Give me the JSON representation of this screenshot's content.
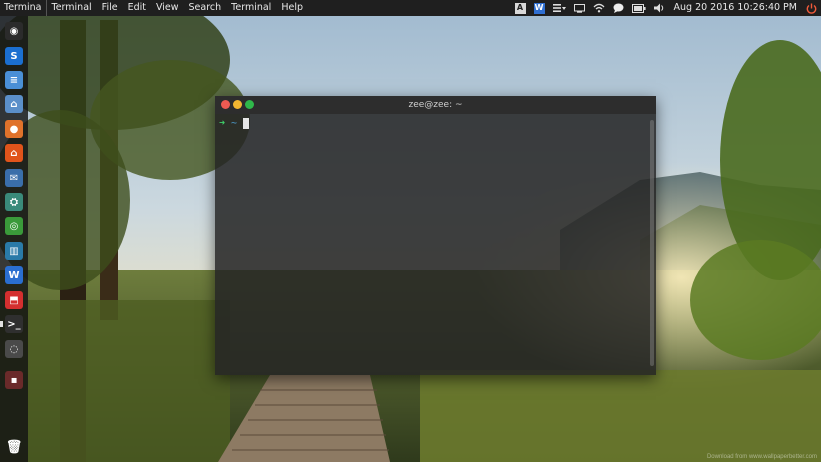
{
  "topbar": {
    "app_name": "Termina",
    "menu": [
      "Terminal",
      "File",
      "Edit",
      "View",
      "Search",
      "Terminal",
      "Help"
    ],
    "tray": {
      "keyboard_label": "A",
      "wps_label": "W",
      "datetime": "Aug 20 2016 10:26:40 PM"
    }
  },
  "launcher": {
    "items": [
      {
        "name": "ubuntu-dash-icon",
        "color": "#2b2b2b",
        "glyph": "◉"
      },
      {
        "name": "skype-icon",
        "color": "#1b6fd0",
        "glyph": "S"
      },
      {
        "name": "text-editor-icon",
        "color": "#4a8fd6",
        "glyph": "≡"
      },
      {
        "name": "files-icon",
        "color": "#5b8fc9",
        "glyph": "⌂"
      },
      {
        "name": "firefox-icon",
        "color": "#e0722b",
        "glyph": "●"
      },
      {
        "name": "software-center-icon",
        "color": "#e0541b",
        "glyph": "⌂"
      },
      {
        "name": "thunderbird-icon",
        "color": "#3a6eaa",
        "glyph": "✉"
      },
      {
        "name": "network-icon",
        "color": "#3a8a7a",
        "glyph": "⛭"
      },
      {
        "name": "chrome-icon",
        "color": "#3a9a3a",
        "glyph": "◎"
      },
      {
        "name": "audio-mixer-icon",
        "color": "#2a7aa8",
        "glyph": "▥"
      },
      {
        "name": "wps-writer-icon",
        "color": "#2a6ed0",
        "glyph": "W"
      },
      {
        "name": "pdf-reader-icon",
        "color": "#d42f2f",
        "glyph": "⬒"
      },
      {
        "name": "terminal-icon",
        "color": "#2f2f2f",
        "glyph": ">_"
      },
      {
        "name": "disk-icon",
        "color": "#4a4a4a",
        "glyph": "◌"
      },
      {
        "name": "usb-drive-icon",
        "color": "#6a2a2a",
        "glyph": "▪"
      }
    ],
    "trash_glyph": "🗑"
  },
  "terminal": {
    "title": "zee@zee: ~",
    "prompt_arrow": "➜",
    "prompt_cwd": "~"
  },
  "watermark": "Download from www.wallpaperbetter.com"
}
